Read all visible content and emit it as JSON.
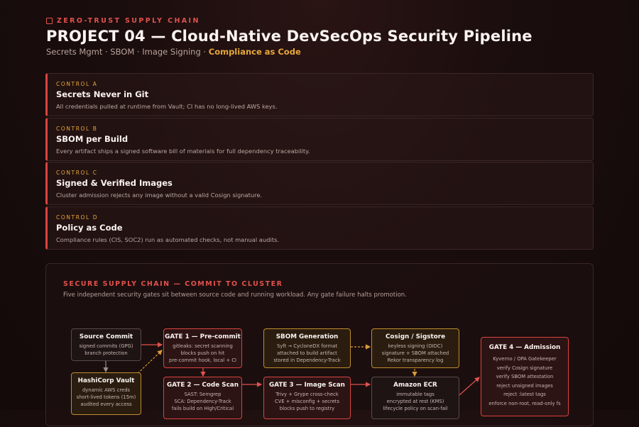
{
  "header": {
    "eyebrow": "ZERO-TRUST SUPPLY CHAIN",
    "title": "PROJECT 04 — Cloud-Native DevSecOps Security Pipeline",
    "subtitle_plain": "Secrets Mgmt · SBOM · Image Signing · ",
    "subtitle_highlight": "Compliance as Code"
  },
  "controls": [
    {
      "tag": "CONTROL A",
      "name": "Secrets Never in Git",
      "desc": "All credentials pulled at runtime from Vault; CI has no long-lived AWS keys."
    },
    {
      "tag": "CONTROL B",
      "name": "SBOM per Build",
      "desc": "Every artifact ships a signed software bill of materials for full dependency traceability."
    },
    {
      "tag": "CONTROL C",
      "name": "Signed & Verified Images",
      "desc": "Cluster admission rejects any image without a valid Cosign signature."
    },
    {
      "tag": "CONTROL D",
      "name": "Policy as Code",
      "desc": "Compliance rules (CIS, SOC2) run as automated checks, not manual audits."
    }
  ],
  "pipeline": {
    "title": "SECURE SUPPLY CHAIN — COMMIT TO CLUSTER",
    "desc": "Five independent security gates sit between source code and running workload. Any gate failure halts promotion.",
    "nodes": {
      "source": {
        "title": "Source Commit",
        "lines": [
          "signed commits (GPG)",
          "branch protection"
        ]
      },
      "vault": {
        "title": "HashiCorp Vault",
        "lines": [
          "dynamic AWS creds",
          "short-lived tokens (15m)",
          "audited every access"
        ]
      },
      "gate1": {
        "title": "GATE 1 — Pre-commit",
        "lines": [
          "gitleaks: secret scanning",
          "blocks push on hit",
          "pre-commit hook, local + CI"
        ]
      },
      "gate2": {
        "title": "GATE 2 — Code Scan",
        "lines": [
          "SAST: Semgrep",
          "SCA: Dependency-Track",
          "fails build on High/Critical"
        ]
      },
      "sbom": {
        "title": "SBOM Generation",
        "lines": [
          "Syft → CycloneDX format",
          "attached to build artifact",
          "stored in Dependency-Track"
        ]
      },
      "gate3": {
        "title": "GATE 3 — Image Scan",
        "lines": [
          "Trivy + Grype cross-check",
          "CVE + misconfig + secrets",
          "blocks push to registry"
        ]
      },
      "cosign": {
        "title": "Cosign / Sigstore",
        "lines": [
          "keyless signing (OIDC)",
          "signature + SBOM attached",
          "Rekor transparency log"
        ]
      },
      "ecr": {
        "title": "Amazon ECR",
        "lines": [
          "immutable tags",
          "encrypted at rest (KMS)",
          "lifecycle policy on scan-fail"
        ]
      },
      "gate4": {
        "title": "GATE 4 — Admission",
        "lines": [
          "Kyverno / OPA Gatekeeper",
          "verify Cosign signature",
          "verify SBOM attestation",
          "reject unsigned images",
          "reject :latest tags",
          "enforce non-root, read-only fs"
        ]
      }
    }
  }
}
